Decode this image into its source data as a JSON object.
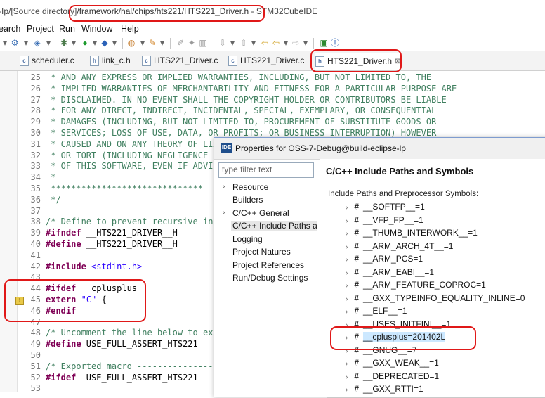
{
  "window": {
    "title_prefix": "-Ip/[Source directory]",
    "title_path": "/framework/hal/chips/hts221/HTS221_Driver.h",
    "title_suffix": " - STM32CubeIDE"
  },
  "menu": [
    "earch",
    "Project",
    "Run",
    "Window",
    "Help"
  ],
  "tabs": [
    {
      "label": "scheduler.c",
      "type": "c"
    },
    {
      "label": "link_c.h",
      "type": "h"
    },
    {
      "label": "HTS221_Driver.c",
      "type": "c"
    },
    {
      "label": "HTS221_Driver.c",
      "type": "c"
    },
    {
      "label": "HTS221_Driver.h",
      "type": "h",
      "active": true,
      "close": "⊠"
    }
  ],
  "code": [
    {
      "n": "25",
      "t": " * AND ANY EXPRESS OR IMPLIED WARRANTIES, INCLUDING, BUT NOT LIMITED TO, THE"
    },
    {
      "n": "26",
      "t": " * IMPLIED WARRANTIES OF MERCHANTABILITY AND FITNESS FOR A PARTICULAR PURPOSE ARE"
    },
    {
      "n": "27",
      "t": " * DISCLAIMED. IN NO EVENT SHALL THE COPYRIGHT HOLDER OR CONTRIBUTORS BE LIABLE"
    },
    {
      "n": "28",
      "t": " * FOR ANY DIRECT, INDIRECT, INCIDENTAL, SPECIAL, EXEMPLARY, OR CONSEQUENTIAL"
    },
    {
      "n": "29",
      "t": " * DAMAGES (INCLUDING, BUT NOT LIMITED TO, PROCUREMENT OF SUBSTITUTE GOODS OR"
    },
    {
      "n": "30",
      "t": " * SERVICES; LOSS OF USE, DATA, OR PROFITS; OR BUSINESS INTERRUPTION) HOWEVER"
    },
    {
      "n": "31",
      "t": " * CAUSED AND ON ANY THEORY OF LIA"
    },
    {
      "n": "32",
      "t": " * OR TORT (INCLUDING NEGLIGENCE"
    },
    {
      "n": "33",
      "t": " * OF THIS SOFTWARE, EVEN IF ADVI"
    },
    {
      "n": "34",
      "t": " *"
    },
    {
      "n": "35",
      "t": " ******************************"
    },
    {
      "n": "36",
      "t": " */"
    },
    {
      "n": "37",
      "t": ""
    },
    {
      "n": "38",
      "t": "/* Define to prevent recursive inc"
    },
    {
      "n": "39",
      "t": "#ifndef __HTS221_DRIVER__H"
    },
    {
      "n": "40",
      "t": "#define __HTS221_DRIVER__H"
    },
    {
      "n": "41",
      "t": ""
    },
    {
      "n": "42",
      "t": "#include <stdint.h>"
    },
    {
      "n": "43",
      "t": ""
    },
    {
      "n": "44",
      "t": "#ifdef __cplusplus"
    },
    {
      "n": "45",
      "t": "extern \"C\" {"
    },
    {
      "n": "46",
      "t": "#endif"
    },
    {
      "n": "47",
      "t": ""
    },
    {
      "n": "48",
      "t": "/* Uncomment the line below to exp"
    },
    {
      "n": "49",
      "t": "#define USE_FULL_ASSERT_HTS221"
    },
    {
      "n": "50",
      "t": ""
    },
    {
      "n": "51",
      "t": "/* Exported macro ---------------"
    },
    {
      "n": "52",
      "t": "#ifdef  USE_FULL_ASSERT_HTS221"
    },
    {
      "n": "53",
      "t": ""
    }
  ],
  "dialog": {
    "icon": "IDE",
    "title": "Properties for OSS-7-Debug@build-eclipse-lp",
    "filter_placeholder": "type filter text",
    "nav": [
      {
        "label": "Resource",
        "expandable": true
      },
      {
        "label": "Builders"
      },
      {
        "label": "C/C++ General",
        "expandable": true
      },
      {
        "label": "C/C++ Include Paths a",
        "selected": true
      },
      {
        "label": "Logging"
      },
      {
        "label": "Project Natures"
      },
      {
        "label": "Project References"
      },
      {
        "label": "Run/Debug Settings"
      }
    ],
    "heading": "C/C++ Include Paths and Symbols",
    "subtitle": "Include Paths and Preprocessor Symbols:",
    "symbols": [
      "__SOFTFP__=1",
      "__VFP_FP__=1",
      "__THUMB_INTERWORK__=1",
      "__ARM_ARCH_4T__=1",
      "__ARM_PCS=1",
      "__ARM_EABI__=1",
      "__ARM_FEATURE_COPROC=1",
      "__GXX_TYPEINFO_EQUALITY_INLINE=0",
      "__ELF__=1",
      "__USES_INITFINI__=1",
      "__cplusplus=201402L",
      "__GNUG__=7",
      "__GXX_WEAK__=1",
      "__DEPRECATED=1",
      "__GXX_RTTI=1"
    ],
    "selected_symbol": "__cplusplus=201402L"
  }
}
